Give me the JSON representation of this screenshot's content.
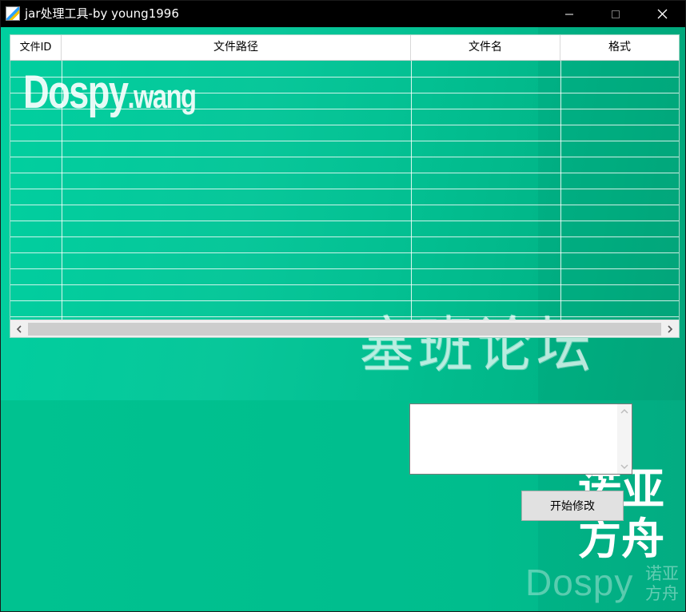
{
  "window": {
    "title": "jar处理工具-by young1996",
    "icons": {
      "app": "app-icon",
      "minimize": "minimize-icon",
      "maximize": "maximize-icon",
      "close": "close-icon"
    }
  },
  "table": {
    "columns": [
      "文件ID",
      "文件路径",
      "文件名",
      "格式"
    ],
    "rows": []
  },
  "watermarks": {
    "dospy_wang_main": "Dospy",
    "dospy_wang_suffix": ".wang",
    "jiban": "塞班论坛",
    "nuoya_big_line1": "诺亚",
    "nuoya_big_line2": "方舟",
    "dospy_logo": "Dospy",
    "nuoya_small_line1": "诺亚",
    "nuoya_small_line2": "方舟"
  },
  "log_area": {
    "value": ""
  },
  "actions": {
    "start_label": "开始修改"
  },
  "colors": {
    "titlebar": "#000000",
    "background_accent": "#00c796",
    "button_face": "#e1e1e1"
  }
}
